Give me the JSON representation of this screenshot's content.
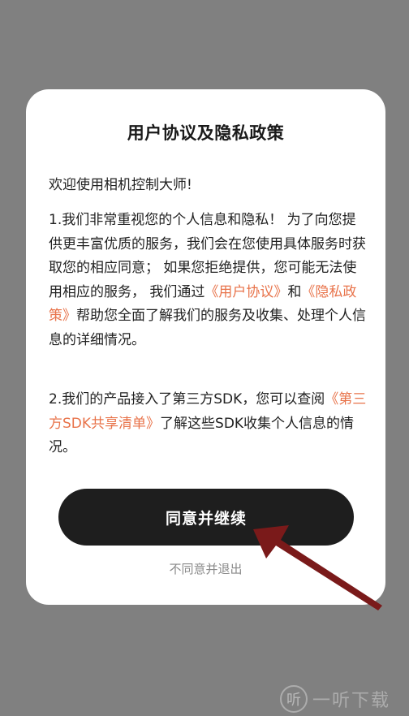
{
  "dialog": {
    "title": "用户协议及隐私政策",
    "welcome": "欢迎使用相机控制大师!",
    "para1": {
      "part1": "1.我们非常重视您的个人信息和隐私！ 为了向您提供更丰富优质的服务，我们会在您使用具体服务时获取您的相应同意； 如果您拒绝提供，您可能无法使用相应的服务， 我们通过",
      "link_user_agreement": "《用户协议》",
      "and": "和",
      "link_privacy_policy": "《隐私政策》",
      "part2": "帮助您全面了解我们的服务及收集、处理个人信息的详细情况。"
    },
    "para2": {
      "part1": "2.我们的产品接入了第三方SDK，您可以查阅",
      "link_sdk_list": "《第三方SDK共享清单》",
      "part2": "了解这些SDK收集个人信息的情况。"
    },
    "agree_button": "同意并继续",
    "disagree_link": "不同意并退出"
  },
  "colors": {
    "overlay": "#808080",
    "link": "#e8734a",
    "button_bg": "#1e1e1e",
    "arrow": "#7a1a1a"
  },
  "watermark": {
    "logo_glyph": "听",
    "text": "一听下载"
  }
}
